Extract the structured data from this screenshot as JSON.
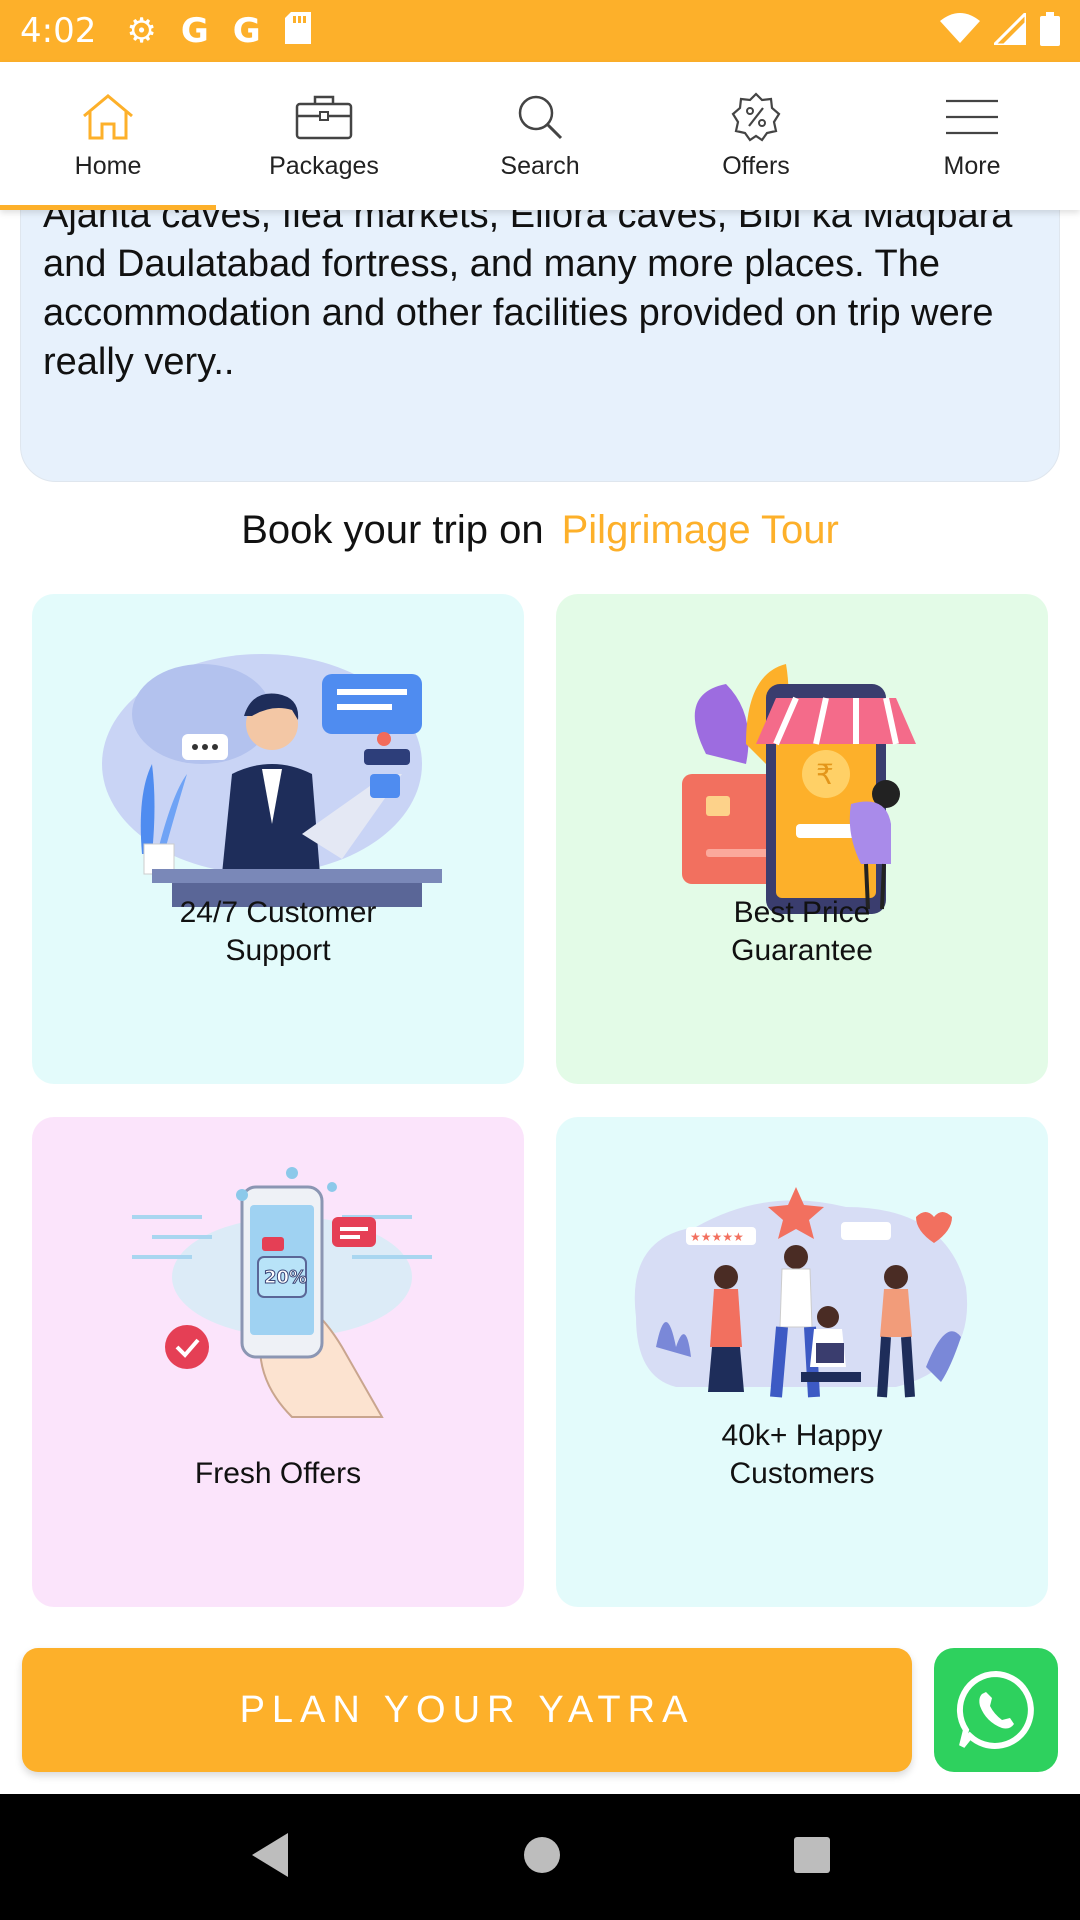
{
  "status_bar": {
    "time": "4:02",
    "icons": [
      "gear-icon",
      "google-icon",
      "google-icon",
      "sd-card-icon",
      "wifi-icon",
      "signal-icon",
      "battery-icon"
    ]
  },
  "nav": {
    "items": [
      {
        "label": "Home",
        "icon": "home-icon",
        "active": true
      },
      {
        "label": "Packages",
        "icon": "briefcase-icon"
      },
      {
        "label": "Search",
        "icon": "search-icon"
      },
      {
        "label": "Offers",
        "icon": "percent-badge-icon"
      },
      {
        "label": "More",
        "icon": "menu-icon"
      }
    ]
  },
  "review": {
    "text": "Ajanta caves, flea markets, Ellora caves, Bibi ka Maqbara and Daulatabad fortress, and many more places. The accommodation and other facilities provided on trip were really very.."
  },
  "book": {
    "prefix": "Book your trip on",
    "brand": "Pilgrimage Tour"
  },
  "features": [
    {
      "label_line1": "24/7 Customer",
      "label_line2": "Support",
      "icon": "customer-support-illustration"
    },
    {
      "label_line1": "Best Price",
      "label_line2": "Guarantee",
      "icon": "best-price-illustration"
    },
    {
      "label_line1": "",
      "label_line2": "Fresh Offers",
      "icon": "fresh-offers-illustration"
    },
    {
      "label_line1": "40k+ Happy",
      "label_line2": "Customers",
      "icon": "happy-customers-illustration"
    }
  ],
  "actions": {
    "plan_label": "PLAN YOUR YATRA",
    "whatsapp_icon": "whatsapp-icon"
  },
  "colors": {
    "accent": "#FDB02A",
    "whatsapp": "#2ED15E",
    "review_bg": "#E7F1FC"
  }
}
